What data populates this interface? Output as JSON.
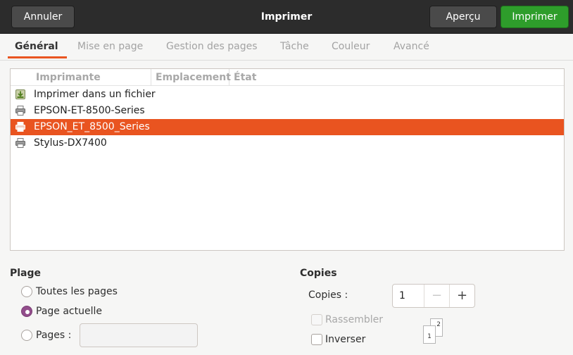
{
  "header": {
    "title": "Imprimer",
    "cancel_label": "Annuler",
    "preview_label": "Aperçu",
    "print_label": "Imprimer",
    "print_color": "#2e9d2b"
  },
  "tabs": [
    {
      "label": "Général",
      "active": true
    },
    {
      "label": "Mise en page",
      "active": false
    },
    {
      "label": "Gestion des pages",
      "active": false
    },
    {
      "label": "Tâche",
      "active": false
    },
    {
      "label": "Couleur",
      "active": false
    },
    {
      "label": "Avancé",
      "active": false
    }
  ],
  "printer_list": {
    "columns": [
      "Imprimante",
      "Emplacement",
      "État"
    ],
    "rows": [
      {
        "name": "Imprimer dans un fichier",
        "icon": "print-to-file-icon",
        "selected": false
      },
      {
        "name": "EPSON-ET-8500-Series",
        "icon": "printer-icon",
        "selected": false
      },
      {
        "name": "EPSON_ET_8500_Series",
        "icon": "printer-icon",
        "selected": true
      },
      {
        "name": "Stylus-DX7400",
        "icon": "printer-icon",
        "selected": false
      }
    ],
    "selection_color": "#e95420"
  },
  "range": {
    "title": "Plage",
    "options": [
      {
        "label": "Toutes les pages",
        "checked": false
      },
      {
        "label": "Page actuelle",
        "checked": true
      },
      {
        "label": "Pages :",
        "checked": false
      }
    ],
    "pages_value": ""
  },
  "copies": {
    "title": "Copies",
    "label": "Copies :",
    "value": "1",
    "minus": "−",
    "plus": "+",
    "collate_label": "Rassembler",
    "collate_checked": false,
    "collate_enabled": false,
    "reverse_label": "Inverser",
    "reverse_checked": false,
    "collate_page_1": "1",
    "collate_page_2": "2"
  }
}
